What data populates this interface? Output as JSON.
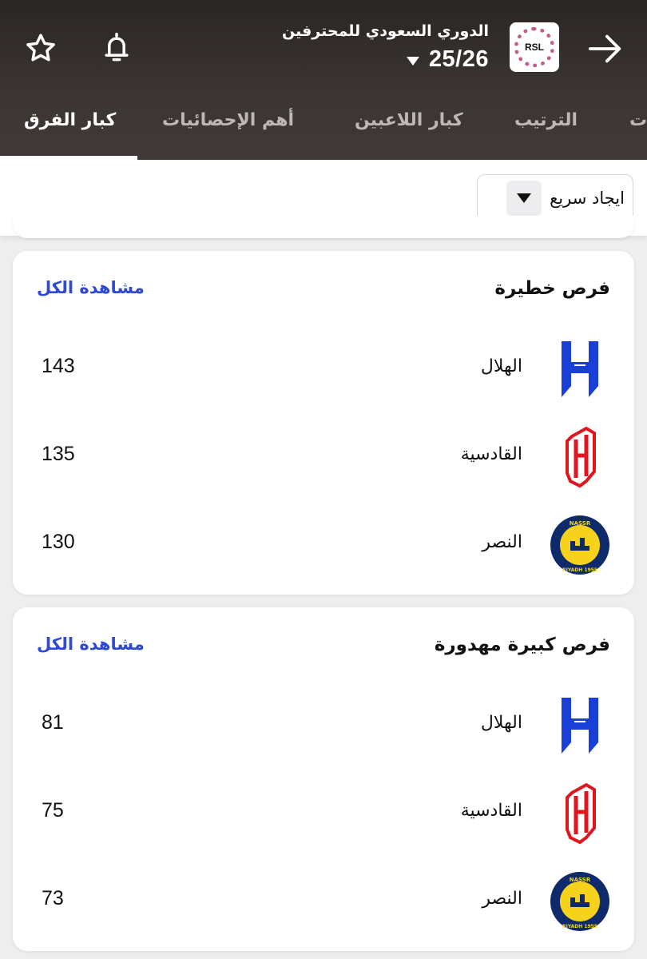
{
  "header": {
    "league_title": "الدوري السعودي للمحترفين",
    "season": "25/26",
    "league_logo_text": "RSL",
    "icons": {
      "back": "arrow-right-icon",
      "notify": "bell-icon",
      "favorite": "star-icon"
    }
  },
  "tabs": [
    {
      "label": "كبار الفرق",
      "active": true
    },
    {
      "label": "أهم الإحصائيات",
      "active": false
    },
    {
      "label": "كبار اللاعبين",
      "active": false
    },
    {
      "label": "الترتيب",
      "active": false
    },
    {
      "label": "ت",
      "active": false
    }
  ],
  "quick_find": {
    "label": "ايجاد سريع"
  },
  "cards": [
    {
      "title": "فرص خطيرة",
      "view_all": "مشاهدة الكل",
      "rows": [
        {
          "team": "الهلال",
          "value": "143",
          "logo": "alhilal-logo"
        },
        {
          "team": "القادسية",
          "value": "135",
          "logo": "alqadsiah-logo"
        },
        {
          "team": "النصر",
          "value": "130",
          "logo": "alnassr-logo"
        }
      ]
    },
    {
      "title": "فرص كبيرة مهدورة",
      "view_all": "مشاهدة الكل",
      "rows": [
        {
          "team": "الهلال",
          "value": "81",
          "logo": "alhilal-logo"
        },
        {
          "team": "القادسية",
          "value": "75",
          "logo": "alqadsiah-logo"
        },
        {
          "team": "النصر",
          "value": "73",
          "logo": "alnassr-logo"
        }
      ]
    }
  ],
  "nassr_logo_text": {
    "top": "NASSR",
    "bottom": "RIYADH 1955"
  },
  "colors": {
    "hilal_blue": "#1a3fd6",
    "qadsiah_red": "#e0151f",
    "nassr_navy": "#0e2a6b",
    "nassr_gold": "#f6d21c",
    "link_blue": "#2f49d1"
  }
}
